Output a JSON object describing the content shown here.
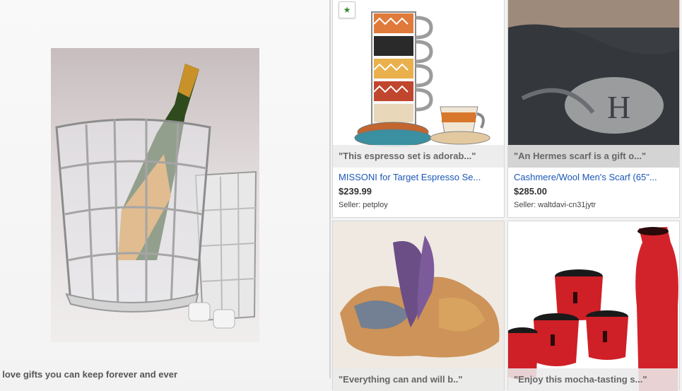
{
  "featured": {
    "quote": "I love gifts you can keep forever and ever"
  },
  "cards": [
    {
      "quote": "\"This espresso set is adorab...\"",
      "title": "MISSONI for Target Espresso Se...",
      "price": "$239.99",
      "seller_label": "Seller:",
      "seller": "petploy",
      "badge": "★"
    },
    {
      "quote": "\"An Hermes scarf is a gift o...\"",
      "title": "Cashmere/Wool Men's Scarf (65\"...",
      "price": "$285.00",
      "seller_label": "Seller:",
      "seller": "waltdavi-cn31jytr"
    },
    {
      "quote": "\"Everything can and will b..\""
    },
    {
      "quote": "\"Enjoy this mocha-tasting s...\""
    }
  ],
  "colors": {
    "link": "#1a57b8",
    "badge_star": "#2e8b2e"
  }
}
